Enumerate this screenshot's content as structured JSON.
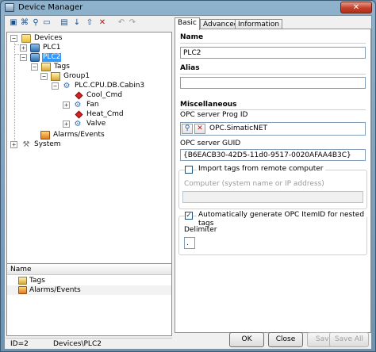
{
  "window": {
    "title": "Device Manager",
    "close_glyph": "✕"
  },
  "toolbar": {
    "icons": [
      "new-device-icon",
      "network-icon",
      "connect-icon",
      "add-folder-icon",
      "sort-icon",
      "up-arrow-icon",
      "delete-icon",
      "undo-icon",
      "redo-icon"
    ]
  },
  "tree": {
    "devices": "Devices",
    "plc1": "PLC1",
    "plc2": "PLC2",
    "tags": "Tags",
    "group1": "Group1",
    "cabin3": "PLC.CPU.DB.Cabin3",
    "cool": "Cool_Cmd",
    "fan": "Fan",
    "heat": "Heat_Cmd",
    "valve": "Valve",
    "alarms": "Alarms/Events",
    "system": "System"
  },
  "list": {
    "header": "Name",
    "rows": [
      {
        "label": "Tags"
      },
      {
        "label": "Alarms/Events"
      }
    ]
  },
  "tabs": {
    "basic": "Basic",
    "advanced": "Advanced",
    "information": "Information"
  },
  "basic": {
    "name_heading": "Name",
    "name_value": "PLC2",
    "alias_heading": "Alias",
    "alias_value": "",
    "misc_heading": "Miscellaneous",
    "progid_label": "OPC server Prog ID",
    "progid_value": "OPC.SimaticNET",
    "guid_label": "OPC server GUID",
    "guid_value": "{B6EACB30-42D5-11d0-9517-0020AFAA4B3C}",
    "import_label": "Import tags from remote computer",
    "remote_label": "Computer (system name or IP address)",
    "remote_value": "",
    "autogen_label": "Automatically generate OPC ItemID for nested tags",
    "autogen_checked": true,
    "import_checked": false,
    "delimiter_label": "Delimiter",
    "delimiter_value": "."
  },
  "status": {
    "id": "ID=2",
    "path": "Devices\\PLC2"
  },
  "buttons": {
    "ok": "OK",
    "close": "Close",
    "save": "Save",
    "save_all": "Save All"
  }
}
